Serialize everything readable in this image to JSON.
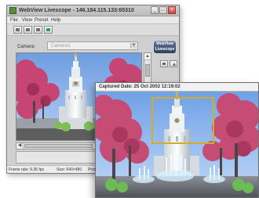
{
  "app": {
    "title": "WebView Livescope - 146.184.115.133:65310",
    "window_controls": {
      "minimize": "_",
      "maximize": "□",
      "close": "×"
    }
  },
  "menu": {
    "items": [
      {
        "label": "File"
      },
      {
        "label": "View"
      },
      {
        "label": "Preset"
      },
      {
        "label": "Help"
      }
    ]
  },
  "camera": {
    "label": "Camera:",
    "selected": "Camera1"
  },
  "brand": {
    "line1": "WebView",
    "line2": "Livescope"
  },
  "status": {
    "frame_rate": "Frame rate: 9.36 fps",
    "size": "Size: 640×480",
    "protocol": "Protocol"
  },
  "capture": {
    "title": "Captured Date: 25 Oct 2002 12:19:02"
  },
  "icons": {
    "toolbar": [
      "camera-icon",
      "record-icon",
      "grid-icon",
      "zoom-icon"
    ],
    "side": [
      "play-icon",
      "up-arrow-icon"
    ],
    "scroll_left": "left-arrow-icon",
    "scroll_right": "right-arrow-icon",
    "scroll_up": "up-arrow-icon",
    "scroll_down": "down-arrow-icon"
  },
  "colors": {
    "sky": "#8db7ef",
    "blossom": "#c44c73",
    "tower": "#e9edf0",
    "frame": "#d2ad25"
  }
}
